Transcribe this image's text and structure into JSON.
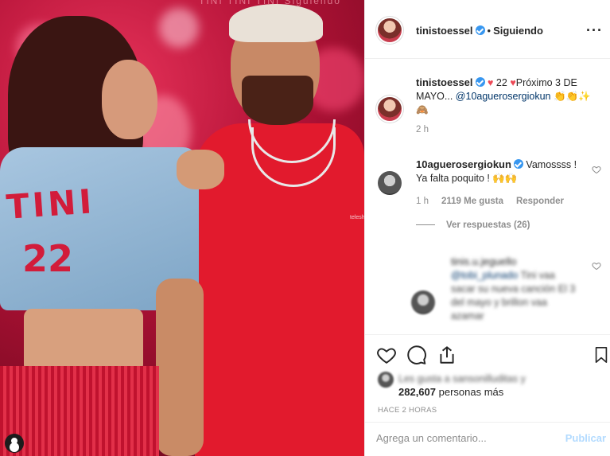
{
  "header": {
    "username": "tinistoessel",
    "separator": "•",
    "follow_status": "Siguiendo",
    "more_icon": "more-options-icon"
  },
  "caption": {
    "username": "tinistoessel",
    "text_prefix": "22",
    "text_main": "Próximo 3 DE MAYO...",
    "mention": "@10aguerosergiokun",
    "emojis": "👏👏✨🙈",
    "time": "2 h"
  },
  "comment_1": {
    "username": "10aguerosergiokun",
    "text": "Vamossss ! Ya falta poquito ! 🙌🙌",
    "time": "1 h",
    "likes": "2119 Me gusta",
    "reply_label": "Responder",
    "view_replies": "Ver respuestas (26)"
  },
  "comment_2": {
    "username": "tinis.u.jeguello",
    "mention": "@tobi_plunado",
    "text": "Tini vaa sacar su nueva canción El 3 del mayo y brillon vaa azamar"
  },
  "actions": {
    "liked_by_text": "Les gusta a sansonilluditas y",
    "likes_count": "282,607",
    "likes_suffix": "personas más",
    "time_ago": "HACE 2 HORAS"
  },
  "comment_box": {
    "placeholder": "Agrega un comentario...",
    "publish_label": "Publicar"
  },
  "photo": {
    "jacket_text": "TINI",
    "jacket_number": "22",
    "top_text": "TINI TINI TINI   Siguiendo",
    "watermark": "teleshow"
  },
  "colors": {
    "verified": "#3897f0",
    "heart": "#ed4956",
    "link": "#003569",
    "publish_disabled": "#b3dbff"
  }
}
